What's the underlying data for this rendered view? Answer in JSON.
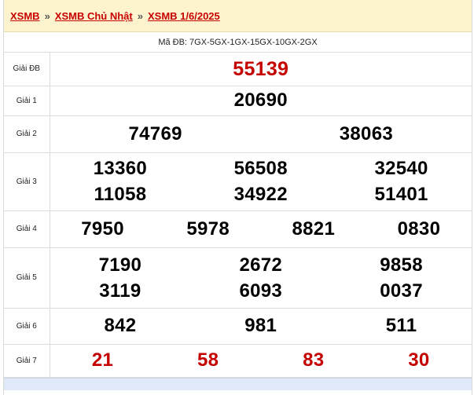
{
  "breadcrumb": {
    "items": [
      "XSMB",
      "XSMB Chủ Nhật",
      "XSMB 1/6/2025"
    ],
    "separator": "»"
  },
  "ma_db": "Mã ĐB: 7GX-5GX-1GX-15GX-10GX-2GX",
  "prizes": {
    "db": {
      "label": "Giải ĐB",
      "values": [
        "55139"
      ]
    },
    "g1": {
      "label": "Giải 1",
      "values": [
        "20690"
      ]
    },
    "g2": {
      "label": "Giải 2",
      "values": [
        "74769",
        "38063"
      ]
    },
    "g3": {
      "label": "Giải 3",
      "values": [
        "13360",
        "56508",
        "32540",
        "11058",
        "34922",
        "51401"
      ]
    },
    "g4": {
      "label": "Giải 4",
      "values": [
        "7950",
        "5978",
        "8821",
        "0830"
      ]
    },
    "g5": {
      "label": "Giải 5",
      "values": [
        "7190",
        "2672",
        "9858",
        "3119",
        "6093",
        "0037"
      ]
    },
    "g6": {
      "label": "Giải 6",
      "values": [
        "842",
        "981",
        "511"
      ]
    },
    "g7": {
      "label": "Giải 7",
      "values": [
        "21",
        "58",
        "83",
        "30"
      ]
    }
  },
  "colors": {
    "accent_red": "#c40000",
    "breadcrumb_bg": "#fdf3cf"
  }
}
